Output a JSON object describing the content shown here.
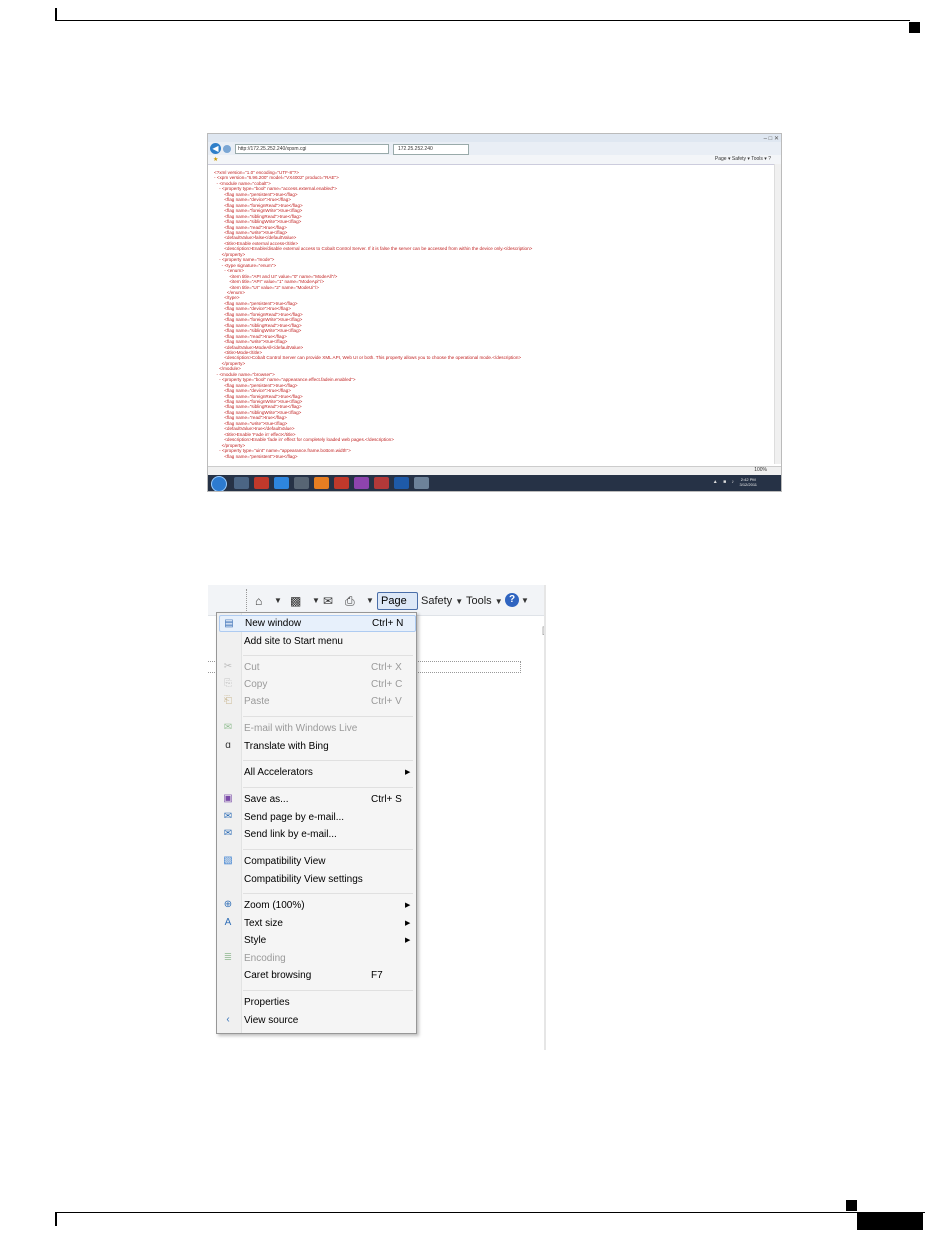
{
  "screenshot1": {
    "address_url": "http://172.25.252.240/xpsm.cgi",
    "tab_label": "172.25.252.240",
    "command_bar": "Page ▾  Safety ▾  Tools ▾  ?",
    "zoom": "100%",
    "clock_time": "2:42 PM",
    "clock_date": "3/12/2011",
    "xml_lines": [
      "<?xml version=\"1.0\" encoding=\"UTF-8\"?>",
      "- <xpm version=\"6.96.200\" model=\"VX4002\" product=\"RAE\">",
      "  - <module name=\"cobalt\">",
      "    - <property type=\"bool\" name=\"access.external.enabled\">",
      "        <flag name=\"persistent\">true</flag>",
      "        <flag name=\"device\">true</flag>",
      "        <flag name=\"foreignRead\">true</flag>",
      "        <flag name=\"foreignWrite\">true</flag>",
      "        <flag name=\"siblingRead\">true</flag>",
      "        <flag name=\"siblingWrite\">true</flag>",
      "        <flag name=\"read\">true</flag>",
      "        <flag name=\"write\">true</flag>",
      "        <defaultValue>false</defaultValue>",
      "        <title>Enable external access</title>",
      "        <description>Enable/disable external access to Cobalt Control Server. If it is false the server can be accessed from within the device only.</description>",
      "      </property>",
      "    - <property name=\"mode\">",
      "      - <type signature=\"enum\">",
      "        - <enum>",
      "            <item title=\"API and UI\" value=\"0\" name=\"ModeAll\"/>",
      "            <item title=\"API\" value=\"1\" name=\"ModeApi\"/>",
      "            <item title=\"UI\" value=\"2\" name=\"ModeUi\"/>",
      "          </enum>",
      "        </type>",
      "        <flag name=\"persistent\">true</flag>",
      "        <flag name=\"device\">true</flag>",
      "        <flag name=\"foreignRead\">true</flag>",
      "        <flag name=\"foreignWrite\">true</flag>",
      "        <flag name=\"siblingRead\">true</flag>",
      "        <flag name=\"siblingWrite\">true</flag>",
      "        <flag name=\"read\">true</flag>",
      "        <flag name=\"write\">true</flag>",
      "        <defaultValue>ModeAll</defaultValue>",
      "        <title>Mode</title>",
      "        <description>Cobalt Control Server can provide XML API, Web UI or both. This property allows you to choose the operational mode.</description>",
      "      </property>",
      "    </module>",
      "  - <module name=\"browser\">",
      "    - <property type=\"bool\" name=\"appearance.effect.fadein.enabled\">",
      "        <flag name=\"persistent\">true</flag>",
      "        <flag name=\"device\">true</flag>",
      "        <flag name=\"foreignRead\">true</flag>",
      "        <flag name=\"foreignWrite\">true</flag>",
      "        <flag name=\"siblingRead\">true</flag>",
      "        <flag name=\"siblingWrite\">true</flag>",
      "        <flag name=\"read\">true</flag>",
      "        <flag name=\"write\">true</flag>",
      "        <defaultValue>true</defaultValue>",
      "        <title>Enable 'Fade in' effect</title>",
      "        <description>Enable 'fade in' effect for completely loaded web pages.</description>",
      "      </property>",
      "    - <property type=\"uint\" name=\"appearance.frame.bottom.width\">",
      "        <flag name=\"persistent\">true</flag>"
    ]
  },
  "screenshot2": {
    "toolbar": {
      "page_label": "Page",
      "safety_label": "Safety",
      "tools_label": "Tools",
      "help_label": "?"
    },
    "menu_items": [
      {
        "label": "New window",
        "shortcut": "Ctrl+ N",
        "icon": "new-window-icon"
      },
      {
        "label": "Add site to Start menu",
        "shortcut": "",
        "icon": ""
      },
      {
        "label": "Cut",
        "shortcut": "Ctrl+ X",
        "icon": "cut-icon"
      },
      {
        "label": "Copy",
        "shortcut": "Ctrl+ C",
        "icon": "copy-icon"
      },
      {
        "label": "Paste",
        "shortcut": "Ctrl+ V",
        "icon": "paste-icon"
      },
      {
        "label": "E-mail with Windows Live",
        "shortcut": "",
        "icon": "email-live-icon"
      },
      {
        "label": "Translate with Bing",
        "shortcut": "",
        "icon": "translate-icon"
      },
      {
        "label": "All Accelerators",
        "shortcut": "",
        "icon": ""
      },
      {
        "label": "Save as...",
        "shortcut": "Ctrl+ S",
        "icon": "save-icon"
      },
      {
        "label": "Send page by e-mail...",
        "shortcut": "",
        "icon": "send-page-icon"
      },
      {
        "label": "Send link by e-mail...",
        "shortcut": "",
        "icon": "send-link-icon"
      },
      {
        "label": "Compatibility View",
        "shortcut": "",
        "icon": "compat-view-icon"
      },
      {
        "label": "Compatibility View settings",
        "shortcut": "",
        "icon": ""
      },
      {
        "label": "Zoom (100%)",
        "shortcut": "",
        "icon": "zoom-icon"
      },
      {
        "label": "Text size",
        "shortcut": "",
        "icon": "text-size-icon"
      },
      {
        "label": "Style",
        "shortcut": "",
        "icon": ""
      },
      {
        "label": "Encoding",
        "shortcut": "",
        "icon": "encoding-icon"
      },
      {
        "label": "Caret browsing",
        "shortcut": "F7",
        "icon": ""
      },
      {
        "label": "Properties",
        "shortcut": "",
        "icon": ""
      },
      {
        "label": "View source",
        "shortcut": "",
        "icon": "view-source-icon"
      }
    ]
  }
}
